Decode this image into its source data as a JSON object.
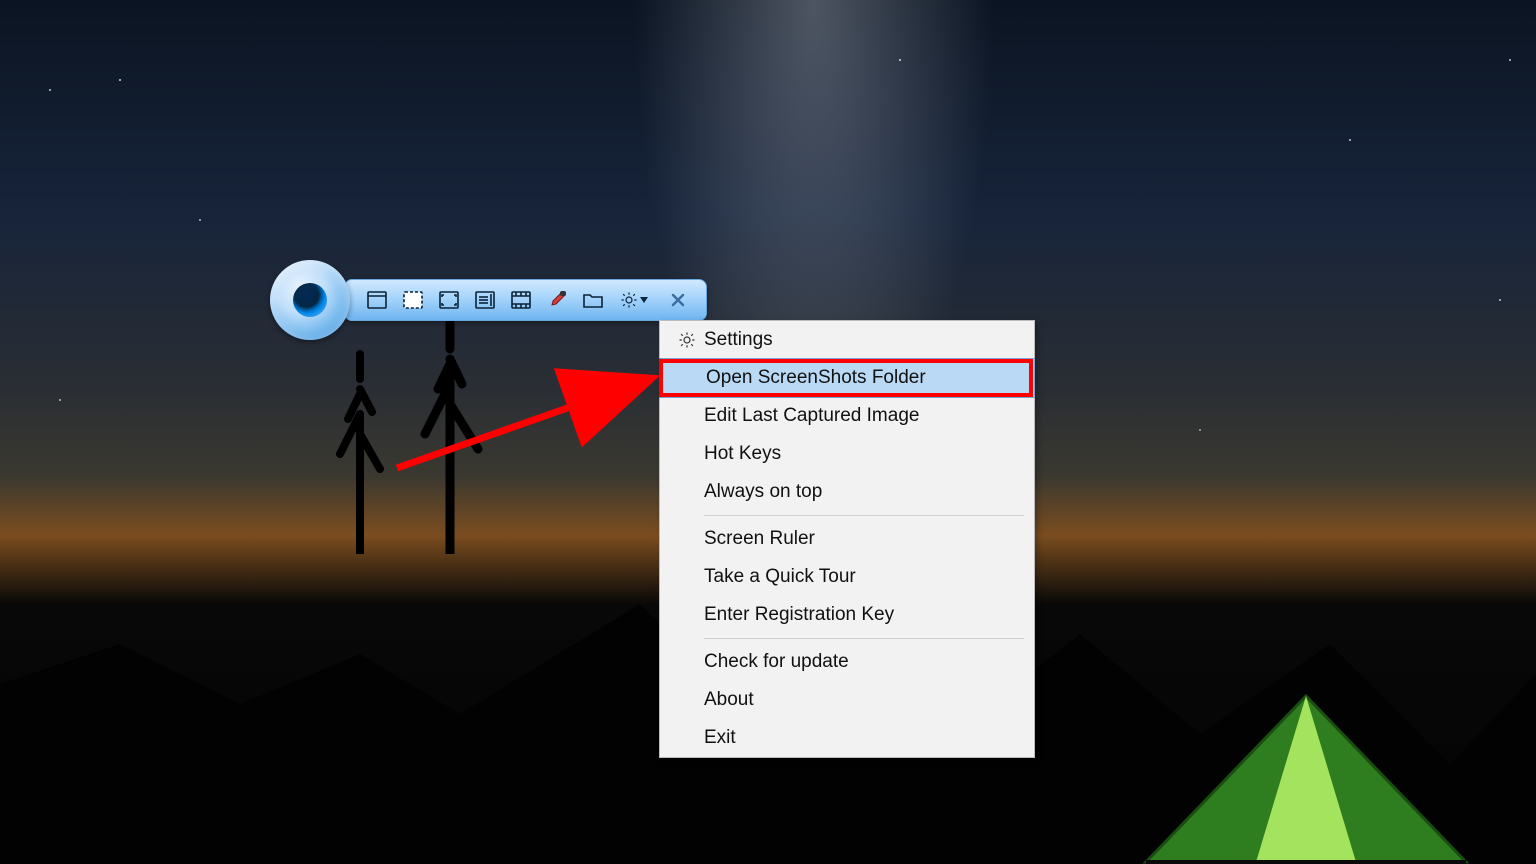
{
  "toolbar": {
    "buttons": [
      {
        "name": "capture-window",
        "icon": "window-icon"
      },
      {
        "name": "capture-region",
        "icon": "region-icon"
      },
      {
        "name": "capture-fullscreen",
        "icon": "fullscreen-icon"
      },
      {
        "name": "capture-scrolling",
        "icon": "scrolling-icon"
      },
      {
        "name": "record-screen",
        "icon": "filmstrip-icon"
      },
      {
        "name": "color-picker",
        "icon": "eyedropper-icon"
      },
      {
        "name": "open-folder",
        "icon": "folder-icon"
      },
      {
        "name": "settings-dropdown",
        "icon": "gear-icon",
        "has_caret": true
      }
    ],
    "close_tooltip": "Close"
  },
  "menu": {
    "groups": [
      [
        {
          "label": "Settings",
          "icon": "gear-icon"
        },
        {
          "label": "Open ScreenShots Folder",
          "highlighted": true,
          "callout": true
        },
        {
          "label": "Edit Last Captured Image"
        },
        {
          "label": "Hot Keys"
        },
        {
          "label": "Always on top"
        }
      ],
      [
        {
          "label": "Screen Ruler"
        },
        {
          "label": "Take a Quick Tour"
        },
        {
          "label": "Enter Registration Key"
        }
      ],
      [
        {
          "label": "Check for update"
        },
        {
          "label": "About"
        },
        {
          "label": "Exit"
        }
      ]
    ]
  },
  "annotation": {
    "arrow_color": "#ff0000"
  }
}
